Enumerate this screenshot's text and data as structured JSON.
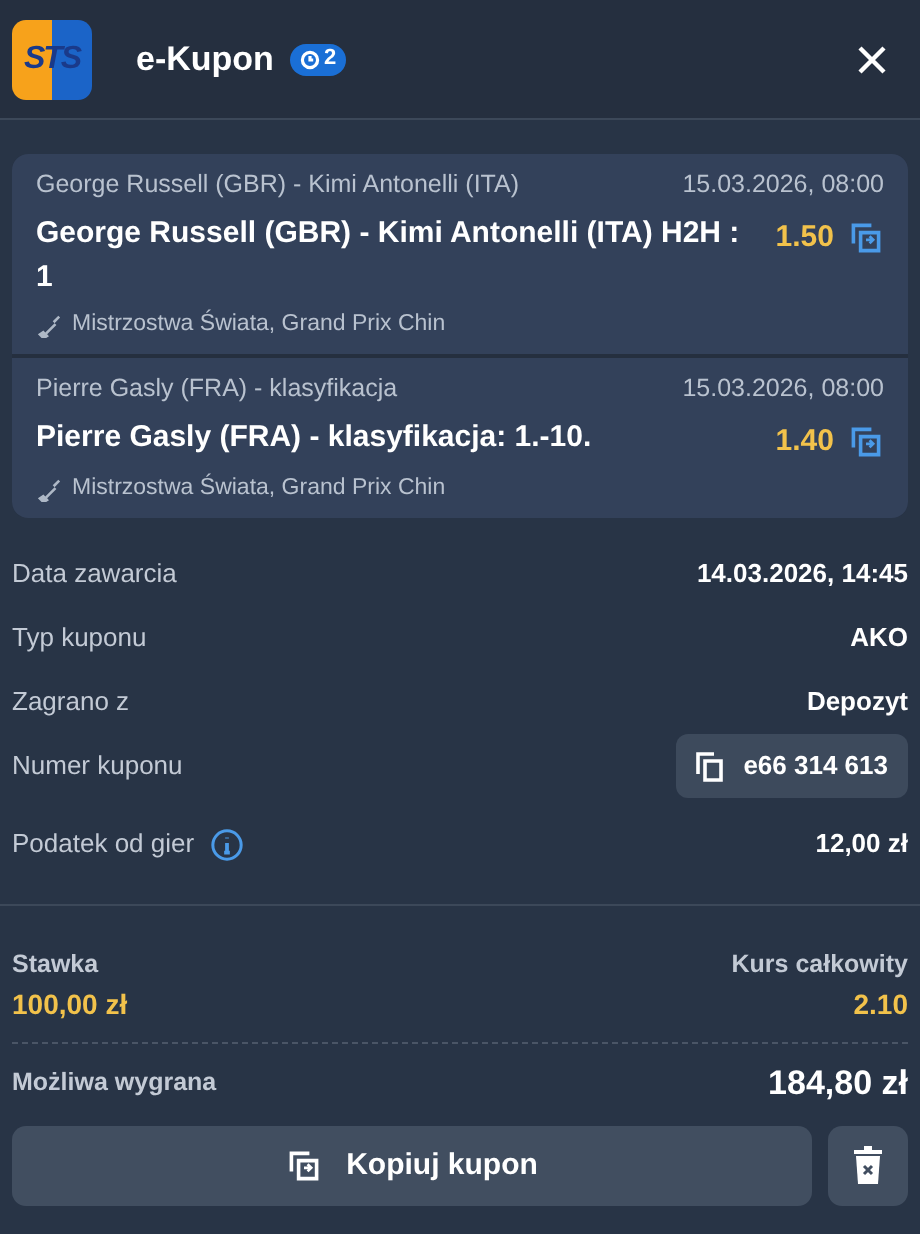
{
  "header": {
    "logo_text": "STS",
    "title": "e-Kupon",
    "badge": "2"
  },
  "bets": [
    {
      "event": "George Russell (GBR) - Kimi Antonelli (ITA)",
      "date": "15.03.2026, 08:00",
      "selection": "George Russell (GBR) - Kimi Antonelli (ITA) H2H : 1",
      "odds": "1.50",
      "league": "Mistrzostwa Świata, Grand Prix Chin"
    },
    {
      "event": "Pierre Gasly (FRA) - klasyfikacja",
      "date": "15.03.2026, 08:00",
      "selection": "Pierre Gasly (FRA) - klasyfikacja: 1.-10.",
      "odds": "1.40",
      "league": "Mistrzostwa Świata, Grand Prix Chin"
    }
  ],
  "details": [
    {
      "kind": "text",
      "label": "Data zawarcia",
      "value": "14.03.2026, 14:45"
    },
    {
      "kind": "text",
      "label": "Typ kuponu",
      "value": "AKO"
    },
    {
      "kind": "text",
      "label": "Zagrano z",
      "value": "Depozyt"
    },
    {
      "kind": "copy",
      "label": "Numer kuponu",
      "value": "e66 314 613"
    },
    {
      "kind": "info",
      "label": "Podatek od gier",
      "value": "12,00 zł"
    }
  ],
  "summary": {
    "stake_label": "Stawka",
    "stake": "100,00 zł",
    "total_odds_label": "Kurs całkowity",
    "total_odds": "2.10",
    "win_label": "Możliwa wygrana",
    "win": "184,80 zł"
  },
  "buttons": {
    "copy": "Kopiuj kupon"
  }
}
